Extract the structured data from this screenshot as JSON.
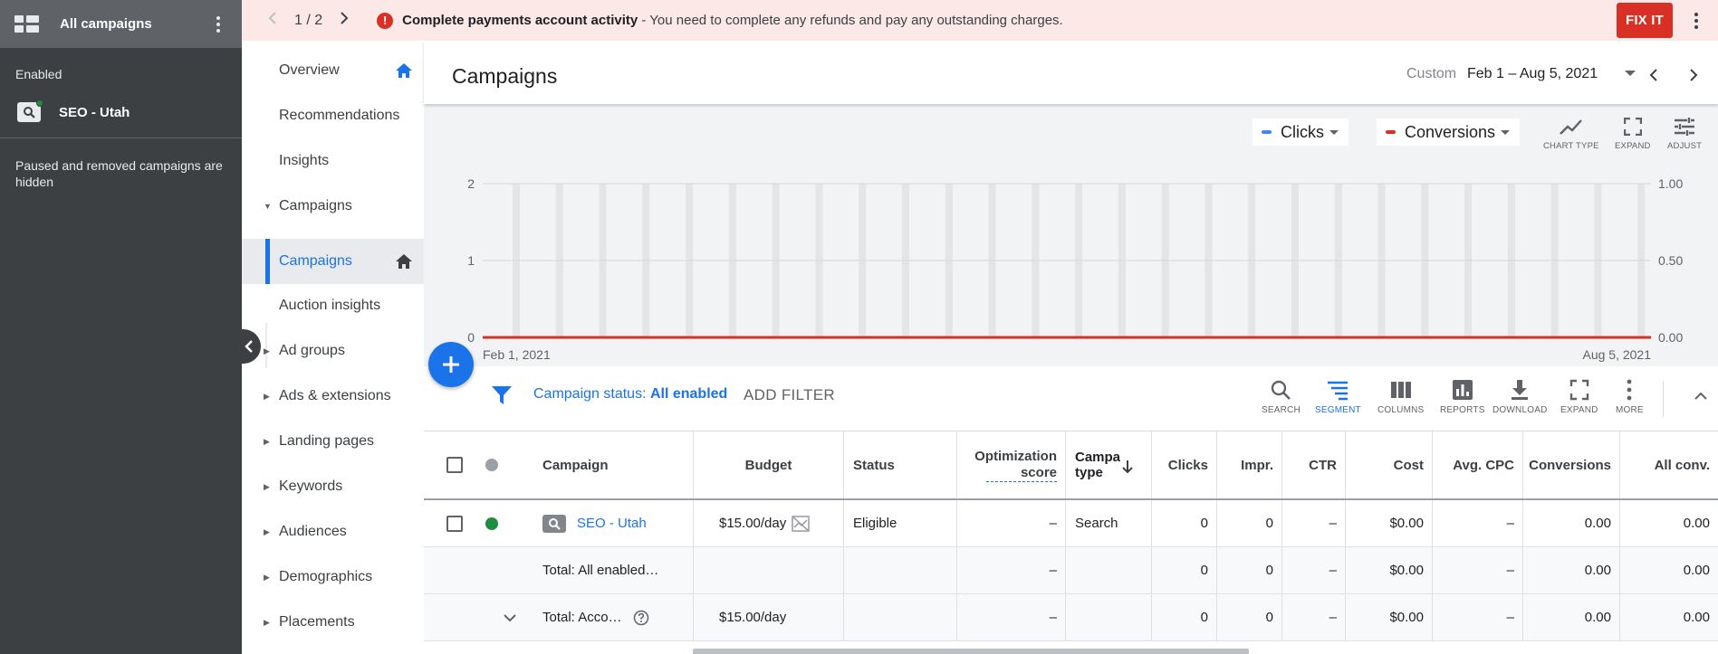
{
  "account": {
    "title": "All campaigns",
    "enabled_label": "Enabled",
    "campaign_name": "SEO - Utah",
    "hidden_note": "Paused and removed campaigns are hidden"
  },
  "alert": {
    "pager": "1 / 2",
    "title": "Complete payments account activity",
    "message": " - You need to complete any refunds and pay any outstanding charges.",
    "action": "FIX IT"
  },
  "nav": {
    "items": [
      {
        "label": "Overview"
      },
      {
        "label": "Recommendations"
      },
      {
        "label": "Insights"
      },
      {
        "label": "Campaigns"
      },
      {
        "label": "Campaigns"
      },
      {
        "label": "Auction insights"
      },
      {
        "label": "Ad groups"
      },
      {
        "label": "Ads & extensions"
      },
      {
        "label": "Landing pages"
      },
      {
        "label": "Keywords"
      },
      {
        "label": "Audiences"
      },
      {
        "label": "Demographics"
      },
      {
        "label": "Placements"
      }
    ]
  },
  "header": {
    "title": "Campaigns",
    "date_mode": "Custom",
    "date_range": "Feb 1 – Aug 5, 2021"
  },
  "chart_controls": {
    "metric1": "Clicks",
    "metric2": "Conversions",
    "chart_type_label": "CHART TYPE",
    "expand_label": "EXPAND",
    "adjust_label": "ADJUST"
  },
  "chart_data": {
    "type": "line",
    "x_start_label": "Feb 1, 2021",
    "x_end_label": "Aug 5, 2021",
    "left_ticks": [
      "0",
      "1",
      "2"
    ],
    "right_ticks": [
      "0.00",
      "0.50",
      "1.00"
    ],
    "ylim_left": [
      0,
      2
    ],
    "ylim_right": [
      0,
      1
    ],
    "series": [
      {
        "name": "Clicks",
        "color": "#4285f4",
        "values": [
          0,
          0
        ]
      },
      {
        "name": "Conversions",
        "color": "#d93025",
        "values": [
          0,
          0
        ]
      }
    ],
    "grid": true
  },
  "filter": {
    "label": "Campaign status: ",
    "value": "All enabled",
    "add_filter": "ADD FILTER"
  },
  "toolbar": {
    "search": "SEARCH",
    "segment": "SEGMENT",
    "columns": "COLUMNS",
    "reports": "REPORTS",
    "download": "DOWNLOAD",
    "expand": "EXPAND",
    "more": "MORE"
  },
  "table": {
    "headers": {
      "campaign": "Campaign",
      "budget": "Budget",
      "status": "Status",
      "opt_score_1": "Optimization",
      "opt_score_2": "score",
      "type_1": "Campa",
      "type_2": "type",
      "clicks": "Clicks",
      "impr": "Impr.",
      "ctr": "CTR",
      "cost": "Cost",
      "avg_cpc": "Avg. CPC",
      "conversions": "Conversions",
      "all_conv": "All conv."
    },
    "row": {
      "campaign": "SEO - Utah",
      "budget": "$15.00/day",
      "status": "Eligible",
      "opt_score": "–",
      "type": "Search",
      "clicks": "0",
      "impr": "0",
      "ctr": "–",
      "cost": "$0.00",
      "avg_cpc": "–",
      "conversions": "0.00",
      "all_conv": "0.00"
    },
    "total_enabled": {
      "label": "Total: All enabled…",
      "opt_score": "–",
      "clicks": "0",
      "impr": "0",
      "ctr": "–",
      "cost": "$0.00",
      "avg_cpc": "–",
      "conversions": "0.00",
      "all_conv": "0.00"
    },
    "total_account": {
      "label": "Total: Acco…",
      "budget": "$15.00/day",
      "opt_score": "–",
      "clicks": "0",
      "impr": "0",
      "ctr": "–",
      "cost": "$0.00",
      "avg_cpc": "–",
      "conversions": "0.00",
      "all_conv": "0.00"
    }
  }
}
